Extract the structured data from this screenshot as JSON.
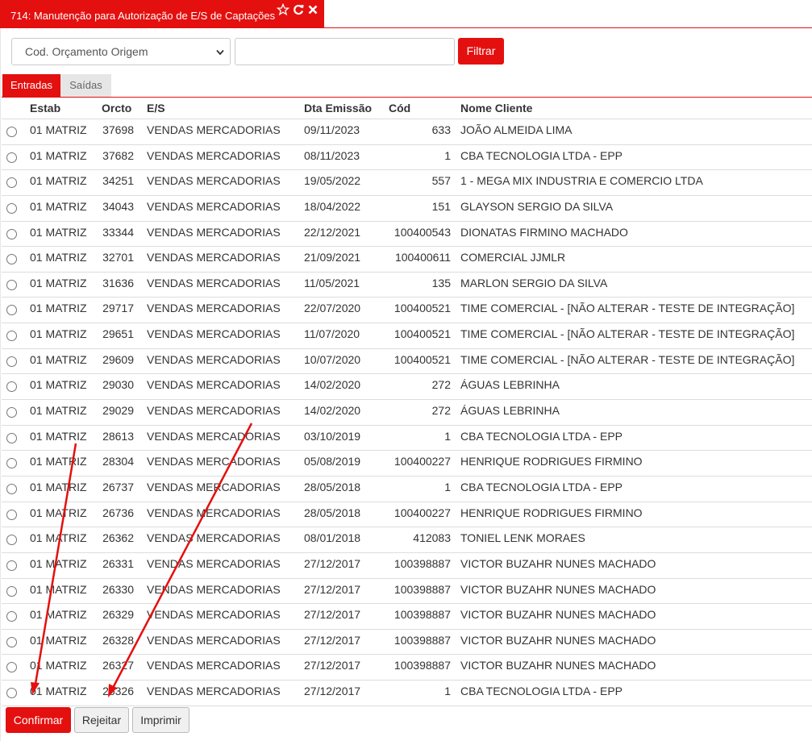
{
  "window": {
    "title": "714: Manutenção para Autorização de E/S de Captações",
    "icons": [
      "star-icon",
      "refresh-icon",
      "close-icon"
    ]
  },
  "filter": {
    "select_value": "Cod. Orçamento Origem",
    "input_value": "",
    "button_label": "Filtrar"
  },
  "tabs": [
    {
      "label": "Entradas",
      "active": true
    },
    {
      "label": "Saídas",
      "active": false
    }
  ],
  "table": {
    "headers": [
      "Estab",
      "Orcto",
      "E/S",
      "Dta Emissão",
      "Cód",
      "Nome Cliente"
    ],
    "rows": [
      [
        "01 MATRIZ",
        "37698",
        "VENDAS MERCADORIAS",
        "09/11/2023",
        "633",
        "JOÃO ALMEIDA LIMA"
      ],
      [
        "01 MATRIZ",
        "37682",
        "VENDAS MERCADORIAS",
        "08/11/2023",
        "1",
        "CBA TECNOLOGIA LTDA - EPP"
      ],
      [
        "01 MATRIZ",
        "34251",
        "VENDAS MERCADORIAS",
        "19/05/2022",
        "557",
        "1 - MEGA MIX INDUSTRIA E COMERCIO LTDA"
      ],
      [
        "01 MATRIZ",
        "34043",
        "VENDAS MERCADORIAS",
        "18/04/2022",
        "151",
        "GLAYSON SERGIO DA SILVA"
      ],
      [
        "01 MATRIZ",
        "33344",
        "VENDAS MERCADORIAS",
        "22/12/2021",
        "100400543",
        "DIONATAS FIRMINO MACHADO"
      ],
      [
        "01 MATRIZ",
        "32701",
        "VENDAS MERCADORIAS",
        "21/09/2021",
        "100400611",
        "COMERCIAL JJMLR"
      ],
      [
        "01 MATRIZ",
        "31636",
        "VENDAS MERCADORIAS",
        "11/05/2021",
        "135",
        "MARLON SERGIO DA SILVA"
      ],
      [
        "01 MATRIZ",
        "29717",
        "VENDAS MERCADORIAS",
        "22/07/2020",
        "100400521",
        "TIME COMERCIAL - [NÃO ALTERAR - TESTE DE INTEGRAÇÃO]"
      ],
      [
        "01 MATRIZ",
        "29651",
        "VENDAS MERCADORIAS",
        "11/07/2020",
        "100400521",
        "TIME COMERCIAL - [NÃO ALTERAR - TESTE DE INTEGRAÇÃO]"
      ],
      [
        "01 MATRIZ",
        "29609",
        "VENDAS MERCADORIAS",
        "10/07/2020",
        "100400521",
        "TIME COMERCIAL - [NÃO ALTERAR - TESTE DE INTEGRAÇÃO]"
      ],
      [
        "01 MATRIZ",
        "29030",
        "VENDAS MERCADORIAS",
        "14/02/2020",
        "272",
        "ÁGUAS LEBRINHA"
      ],
      [
        "01 MATRIZ",
        "29029",
        "VENDAS MERCADORIAS",
        "14/02/2020",
        "272",
        "ÁGUAS LEBRINHA"
      ],
      [
        "01 MATRIZ",
        "28613",
        "VENDAS MERCADORIAS",
        "03/10/2019",
        "1",
        "CBA TECNOLOGIA LTDA - EPP"
      ],
      [
        "01 MATRIZ",
        "28304",
        "VENDAS MERCADORIAS",
        "05/08/2019",
        "100400227",
        "HENRIQUE RODRIGUES FIRMINO"
      ],
      [
        "01 MATRIZ",
        "26737",
        "VENDAS MERCADORIAS",
        "28/05/2018",
        "1",
        "CBA TECNOLOGIA LTDA - EPP"
      ],
      [
        "01 MATRIZ",
        "26736",
        "VENDAS MERCADORIAS",
        "28/05/2018",
        "100400227",
        "HENRIQUE RODRIGUES FIRMINO"
      ],
      [
        "01 MATRIZ",
        "26362",
        "VENDAS MERCADORIAS",
        "08/01/2018",
        "412083",
        "TONIEL LENK MORAES"
      ],
      [
        "01 MATRIZ",
        "26331",
        "VENDAS MERCADORIAS",
        "27/12/2017",
        "100398887",
        "VICTOR BUZAHR NUNES MACHADO"
      ],
      [
        "01 MATRIZ",
        "26330",
        "VENDAS MERCADORIAS",
        "27/12/2017",
        "100398887",
        "VICTOR BUZAHR NUNES MACHADO"
      ],
      [
        "01 MATRIZ",
        "26329",
        "VENDAS MERCADORIAS",
        "27/12/2017",
        "100398887",
        "VICTOR BUZAHR NUNES MACHADO"
      ],
      [
        "01 MATRIZ",
        "26328",
        "VENDAS MERCADORIAS",
        "27/12/2017",
        "100398887",
        "VICTOR BUZAHR NUNES MACHADO"
      ],
      [
        "01 MATRIZ",
        "26327",
        "VENDAS MERCADORIAS",
        "27/12/2017",
        "100398887",
        "VICTOR BUZAHR NUNES MACHADO"
      ],
      [
        "01 MATRIZ",
        "26326",
        "VENDAS MERCADORIAS",
        "27/12/2017",
        "1",
        "CBA TECNOLOGIA LTDA - EPP"
      ]
    ]
  },
  "actions": {
    "confirm_label": "Confirmar",
    "reject_label": "Rejeitar",
    "print_label": "Imprimir"
  },
  "colors": {
    "accent": "#e4100f",
    "annotation_arrow": "#e4100f",
    "tab_inactive_bg": "#e6e6e6",
    "grid_line": "#dddddd"
  }
}
